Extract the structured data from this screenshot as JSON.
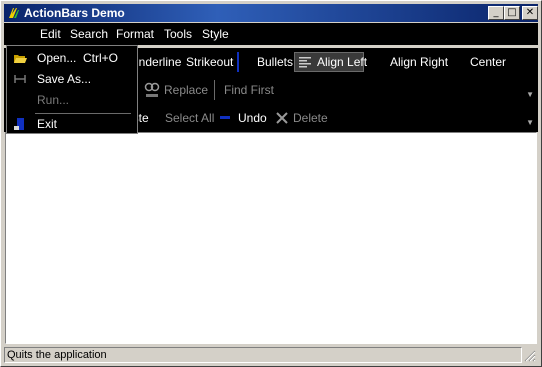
{
  "window": {
    "title": "ActionBars Demo",
    "minimize": "_",
    "maximize": "□",
    "close": "✕"
  },
  "menubar": {
    "items": [
      {
        "label": "Edit"
      },
      {
        "label": "Search"
      },
      {
        "label": "Format"
      },
      {
        "label": "Tools"
      },
      {
        "label": "Style"
      }
    ]
  },
  "file_menu": {
    "items": [
      {
        "label": "Open...",
        "shortcut": "Ctrl+O",
        "icon": "open-folder-icon",
        "enabled": true
      },
      {
        "label": "Save As...",
        "shortcut": "",
        "icon": "save-as-icon",
        "enabled": true
      },
      {
        "label": "Run...",
        "shortcut": "",
        "icon": "",
        "enabled": false
      },
      {
        "label": "Exit",
        "shortcut": "",
        "icon": "exit-door-icon",
        "enabled": true
      }
    ]
  },
  "format_toolbar": {
    "underline": "Underline",
    "strikeout": "Strikeout",
    "bullets": "Bullets",
    "align_left": "Align Left",
    "align_right": "Align Right",
    "center": "Center"
  },
  "search_toolbar": {
    "replace": "Replace",
    "find_first": "Find First"
  },
  "edit_toolbar": {
    "paste": "Paste",
    "select_all": "Select All",
    "undo": "Undo",
    "delete": "Delete"
  },
  "statusbar": {
    "text": "Quits the application"
  },
  "colors": {
    "titlebar": "#0a246a",
    "toolbar": "#000000",
    "face": "#d4d0c8"
  }
}
